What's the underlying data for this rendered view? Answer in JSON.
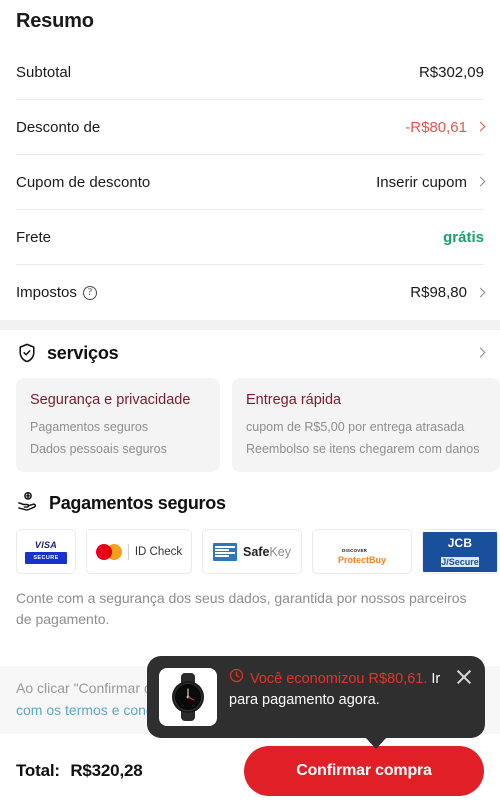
{
  "summary": {
    "title": "Resumo",
    "rows": [
      {
        "label": "Subtotal",
        "value": "R$302,09",
        "style": "plain",
        "chevron": false,
        "info": false
      },
      {
        "label": "Desconto de",
        "value": "-R$80,61",
        "style": "discount",
        "chevron": true,
        "info": false
      },
      {
        "label": "Cupom de desconto",
        "value": "Inserir cupom",
        "style": "plain",
        "chevron": true,
        "info": false
      },
      {
        "label": "Frete",
        "value": "grátis",
        "style": "free",
        "chevron": false,
        "info": false
      },
      {
        "label": "Impostos",
        "value": "R$98,80",
        "style": "plain",
        "chevron": true,
        "info": true
      }
    ]
  },
  "services": {
    "icon": "shield-check-icon",
    "title": "serviços",
    "chevron_label": "›",
    "cards": [
      {
        "title": "Segurança e privacidade",
        "lines": [
          "Pagamentos seguros",
          "Dados pessoais seguros"
        ]
      },
      {
        "title": "Entrega rápida",
        "lines": [
          "cupom de R$5,00 por entrega atrasada",
          "Reembolso se itens chegarem com danos"
        ]
      }
    ]
  },
  "payments": {
    "icon": "hand-coin-icon",
    "title": "Pagamentos seguros",
    "badges": [
      {
        "name": "visa-secure-badge",
        "primary": "VISA",
        "secondary": "SECURE"
      },
      {
        "name": "mastercard-id-check-badge",
        "primary": "",
        "secondary": "ID Check"
      },
      {
        "name": "amex-safekey-badge",
        "primary": "Safe",
        "secondary": "Key"
      },
      {
        "name": "discover-protectbuy-badge",
        "primary": "DISCOVER",
        "secondary": "ProtectBuy"
      },
      {
        "name": "jcb-jsecure-badge",
        "primary": "JCB",
        "secondary": "J/Secure"
      }
    ],
    "note": "Conte com a segurança dos seus dados, garantida por nossos parceiros de pagamento."
  },
  "terms": {
    "line1_prefix": "Ao clicar \"Confirmar compra\", você concorda",
    "line2_link": "com os termos e condições"
  },
  "bottom": {
    "total_label": "Total:",
    "total_value": "R$320,28",
    "cta_label": "Confirmar compra"
  },
  "tooltip": {
    "icon": "clock-icon",
    "thumb": "smartwatch-thumbnail",
    "headline": "Você economizou",
    "amount": "R$80,61.",
    "rest": "Ir para pagamento agora.",
    "close_label": "close-icon"
  },
  "colors": {
    "accent_red": "#e01f26",
    "discount_red": "#e2574c",
    "free_green": "#16a36a",
    "card_title": "#7a1c2e",
    "tooltip_bg": "#2f2f2f",
    "tooltip_red": "#e63329",
    "link_blue": "#5aa8c7"
  }
}
